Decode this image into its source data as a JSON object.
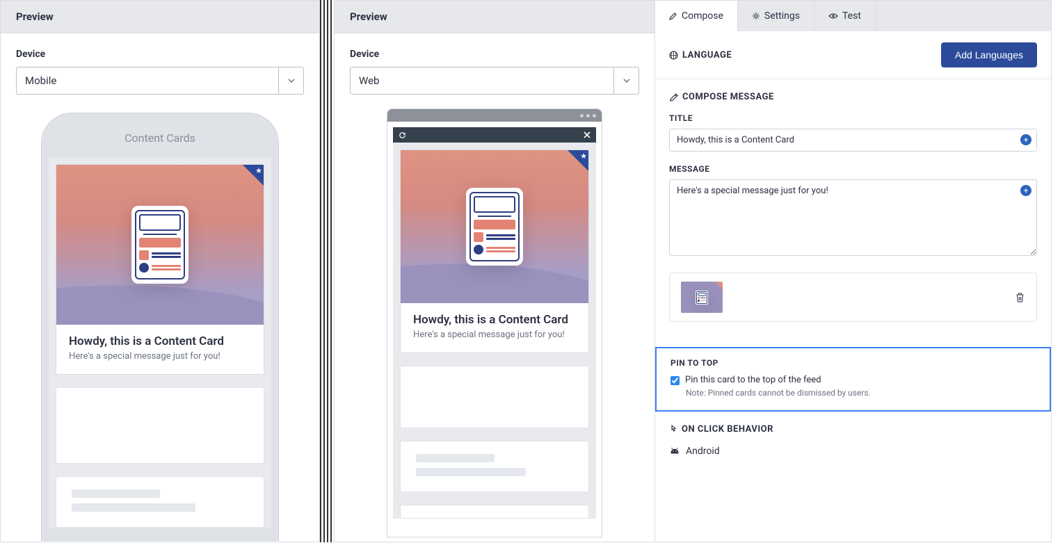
{
  "left": {
    "header": "Preview",
    "device_label": "Device",
    "device_value": "Mobile",
    "mobile_title": "Content Cards",
    "card_title": "Howdy, this is a Content Card",
    "card_msg": "Here's a special message just for you!"
  },
  "right": {
    "preview_header": "Preview",
    "device_label": "Device",
    "device_value": "Web",
    "card_title": "Howdy, this is a Content Card",
    "card_msg": "Here's a special message just for you!",
    "tabs": {
      "compose": "Compose",
      "settings": "Settings",
      "test": "Test"
    },
    "language_heading": "LANGUAGE",
    "add_languages": "Add Languages",
    "compose_heading": "COMPOSE MESSAGE",
    "title_label": "TITLE",
    "title_value": "Howdy, this is a Content Card",
    "message_label": "MESSAGE",
    "message_value": "Here's a special message just for you!",
    "pin_heading": "PIN TO TOP",
    "pin_checkbox_label": "Pin this card to the top of the feed",
    "pin_note": "Note: Pinned cards cannot be dismissed by users.",
    "pin_checked": true,
    "onclick_heading": "ON CLICK BEHAVIOR",
    "platform_android": "Android"
  }
}
